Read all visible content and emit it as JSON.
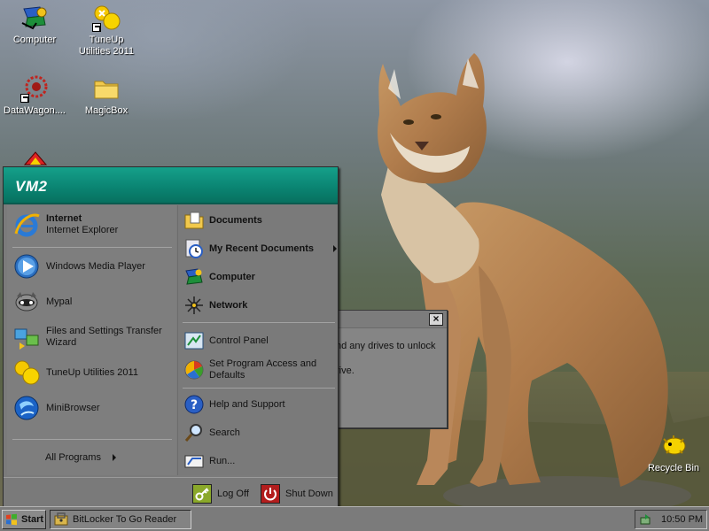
{
  "desktop": {
    "icons": [
      {
        "label": "Computer",
        "icon": "computer-icon"
      },
      {
        "label": "TuneUp Utilities 2011",
        "icon": "tuneup-icon"
      },
      {
        "label": "DataWagon....",
        "icon": "datawagon-icon"
      },
      {
        "label": "MagicBox",
        "icon": "folder-icon"
      },
      {
        "label": "Recycle Bin",
        "icon": "recycle-bin-icon"
      }
    ]
  },
  "dialog": {
    "line1": "nd any drives to unlock",
    "line2": "rive."
  },
  "start_menu": {
    "user": "VM2",
    "left": {
      "pinned": [
        {
          "title": "Internet",
          "subtitle": "Internet Explorer",
          "icon": "internet-explorer-icon"
        }
      ],
      "programs": [
        {
          "label": "Windows Media Player",
          "icon": "media-player-icon"
        },
        {
          "label": "Mypal",
          "icon": "mypal-icon"
        },
        {
          "label": "Files and Settings Transfer Wizard",
          "icon": "transfer-wizard-icon"
        },
        {
          "label": "TuneUp Utilities 2011",
          "icon": "tuneup-icon"
        },
        {
          "label": "MiniBrowser",
          "icon": "minibrowser-icon"
        }
      ],
      "all_programs": "All Programs"
    },
    "right": {
      "items": [
        {
          "label": "Documents",
          "icon": "documents-icon"
        },
        {
          "label": "My Recent Documents",
          "icon": "recent-documents-icon"
        },
        {
          "label": "Computer",
          "icon": "computer-icon"
        },
        {
          "label": "Network",
          "icon": "network-icon"
        },
        {
          "label": "Control Panel",
          "icon": "control-panel-icon"
        },
        {
          "label": "Set Program Access and Defaults",
          "icon": "program-access-icon"
        },
        {
          "label": "Help and Support",
          "icon": "help-icon"
        },
        {
          "label": "Search",
          "icon": "search-icon"
        },
        {
          "label": "Run...",
          "icon": "run-icon"
        }
      ]
    },
    "footer": {
      "log_off": "Log Off",
      "shut_down": "Shut Down"
    }
  },
  "taskbar": {
    "start_label": "Start",
    "tasks": [
      {
        "label": "BitLocker To Go Reader",
        "icon": "bitlocker-icon"
      }
    ],
    "clock": "10:50 PM"
  }
}
